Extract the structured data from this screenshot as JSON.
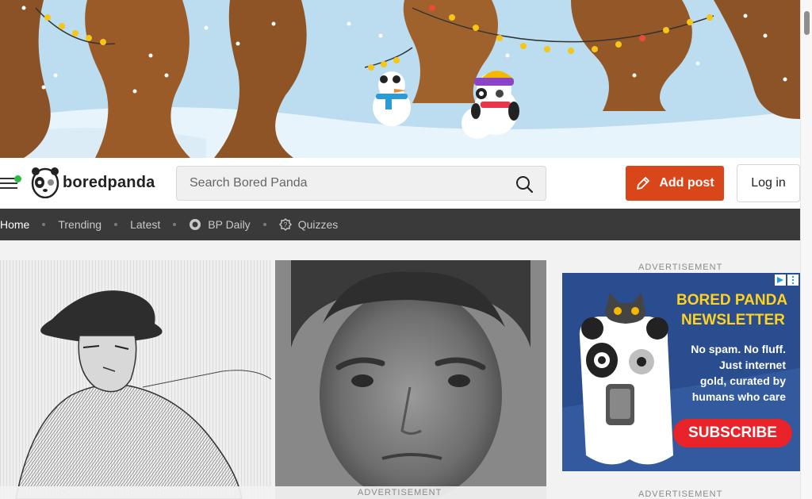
{
  "header": {
    "brand": "boredpanda",
    "search_placeholder": "Search Bored Panda",
    "add_post_label": "Add post",
    "login_label": "Log in"
  },
  "nav": {
    "items": [
      {
        "label": "Home",
        "icon": null,
        "active": true
      },
      {
        "label": "Trending",
        "icon": null
      },
      {
        "label": "Latest",
        "icon": null
      },
      {
        "label": "BP Daily",
        "icon": "clock-badge-icon"
      },
      {
        "label": "Quizzes",
        "icon": "quiz-badge-icon"
      }
    ]
  },
  "ads": {
    "sidebar_label": "ADVERTISEMENT",
    "bottom_label": "ADVERTISEMENT",
    "sidebar_bottom_label": "ADVERTISEMENT",
    "newsletter_title_line1": "BORED PANDA",
    "newsletter_title_line2": "NEWSLETTER",
    "newsletter_body": [
      "No spam. No fluff.",
      "Just internet",
      "gold, curated by",
      "humans who care"
    ],
    "subscribe_label": "SUBSCRIBE"
  },
  "colors": {
    "accent": "#d9461a",
    "nav_bg": "#3a3a3a",
    "online_dot": "#2eb84b",
    "ad_bg": "#2a4d8f",
    "ad_title": "#ffd21f"
  }
}
